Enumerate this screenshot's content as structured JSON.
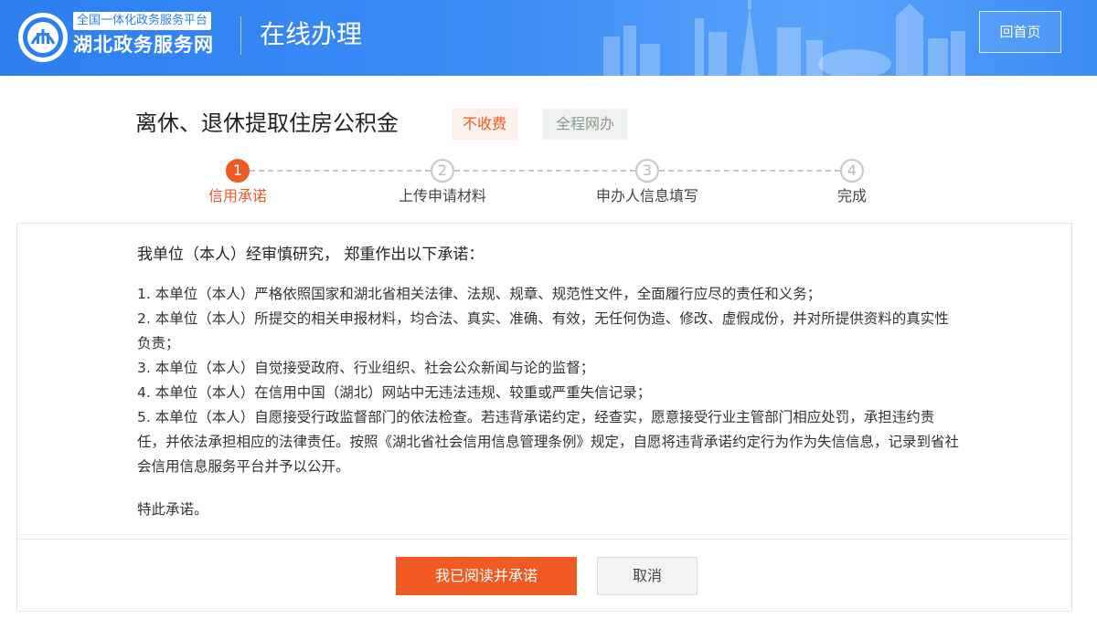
{
  "header": {
    "site_subtitle": "全国一体化政务服务平台",
    "site_name": "湖北政务服务网",
    "section_title": "在线办理",
    "home_button": "回首页"
  },
  "service": {
    "title": "离休、退休提取住房公积金",
    "tag_fee": "不收费",
    "tag_online": "全程网办"
  },
  "steps": [
    {
      "number": "1",
      "label": "信用承诺",
      "active": true
    },
    {
      "number": "2",
      "label": "上传申请材料",
      "active": false
    },
    {
      "number": "3",
      "label": "申办人信息填写",
      "active": false
    },
    {
      "number": "4",
      "label": "完成",
      "active": false
    }
  ],
  "promise": {
    "heading": "我单位（本人）经审慎研究， 郑重作出以下承诺：",
    "items": [
      "1. 本单位（本人）严格依照国家和湖北省相关法律、法规、规章、规范性文件，全面履行应尽的责任和义务；",
      "2. 本单位（本人）所提交的相关申报材料，均合法、真实、准确、有效，无任何伪造、修改、虚假成份，并对所提供资料的真实性负责；",
      "3. 本单位（本人）自觉接受政府、行业组织、社会公众新闻与论的监督；",
      "4. 本单位（本人）在信用中国（湖北）网站中无违法违规、较重或严重失信记录；",
      "5. 本单位（本人）自愿接受行政监督部门的依法检查。若违背承诺约定，经查实，愿意接受行业主管部门相应处罚，承担违约责任，并依法承担相应的法律责任。按照《湖北省社会信用信息管理条例》规定，自愿将违背承诺约定行为作为失信信息，记录到省社会信用信息服务平台并予以公开。"
    ],
    "closing": "特此承诺。"
  },
  "actions": {
    "agree_label": "我已阅读并承诺",
    "cancel_label": "取消"
  },
  "colors": {
    "header_blue": "#2d7ff0",
    "accent_orange": "#ef5b25",
    "tag_fee_bg": "#fdf0ea",
    "tag_online_bg": "#eef3ef"
  }
}
